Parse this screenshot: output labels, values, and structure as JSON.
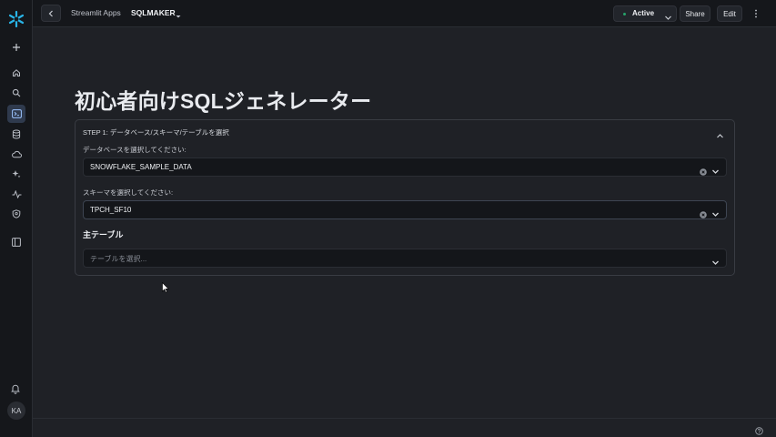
{
  "nav": {
    "breadcrumb_parent": "Streamlit Apps",
    "app_name": "SQLMAKER",
    "status": "Active",
    "share_label": "Share",
    "edit_label": "Edit",
    "user_initials": "KA"
  },
  "page": {
    "title": "初心者向けSQLジェネレーター"
  },
  "step1": {
    "header": "STEP 1: データベース/スキーマ/テーブルを選択",
    "database_label": "データベースを選択してください:",
    "database_value": "SNOWFLAKE_SAMPLE_DATA",
    "schema_label": "スキーマを選択してください:",
    "schema_value": "TPCH_SF10",
    "main_table_label": "主テーブル",
    "table_placeholder": "テーブルを選択..."
  },
  "colors": {
    "accent_brand": "#29b5e8",
    "status_active": "#27a36b",
    "background": "#1f2126"
  }
}
